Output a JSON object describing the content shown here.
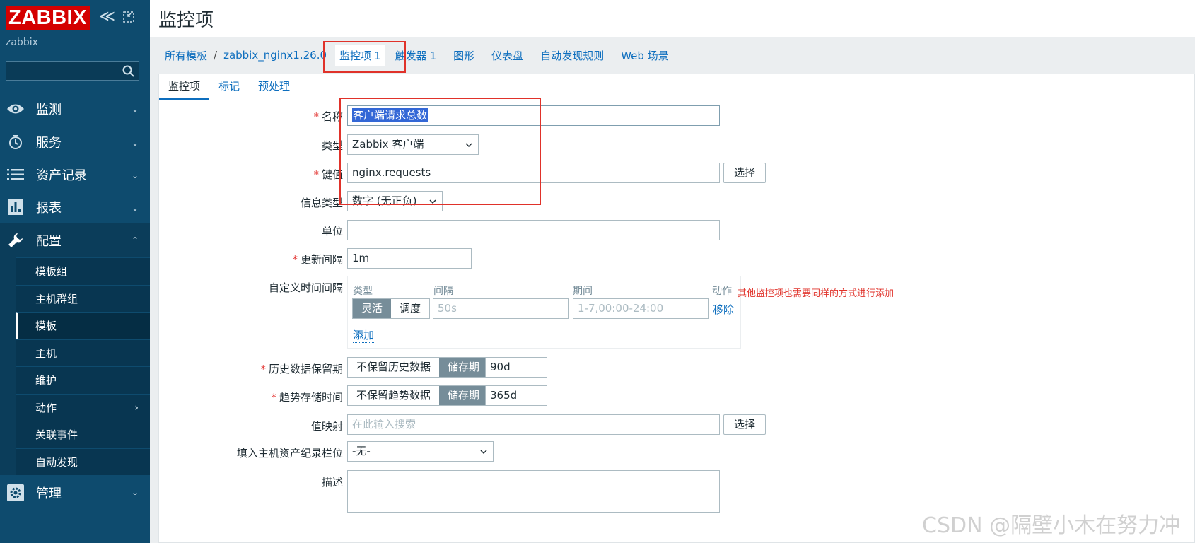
{
  "sidebar": {
    "logo": "ZABBIX",
    "server_name": "zabbix",
    "collapse_glyph": "≪",
    "menu": [
      {
        "label": "监测",
        "icon": "eye-icon",
        "arrow": "⌄"
      },
      {
        "label": "服务",
        "icon": "clock-icon",
        "arrow": "⌄"
      },
      {
        "label": "资产记录",
        "icon": "list-icon",
        "arrow": "⌄"
      },
      {
        "label": "报表",
        "icon": "bar-chart-icon",
        "arrow": "⌄"
      },
      {
        "label": "配置",
        "icon": "wrench-icon",
        "arrow": "⌃"
      },
      {
        "label": "管理",
        "icon": "gear-icon",
        "arrow": "⌄"
      }
    ],
    "submenu": [
      {
        "label": "模板组"
      },
      {
        "label": "主机群组"
      },
      {
        "label": "模板"
      },
      {
        "label": "主机"
      },
      {
        "label": "维护"
      },
      {
        "label": "动作",
        "arrow": "›"
      },
      {
        "label": "关联事件"
      },
      {
        "label": "自动发现"
      }
    ]
  },
  "header": {
    "title": "监控项"
  },
  "breadcrumb": {
    "all_templates": "所有模板",
    "separator": "/",
    "template": "zabbix_nginx1.26.0",
    "tabs": [
      {
        "label": "监控项",
        "count": "1"
      },
      {
        "label": "触发器",
        "count": "1"
      },
      {
        "label": "图形"
      },
      {
        "label": "仪表盘"
      },
      {
        "label": "自动发现规则"
      },
      {
        "label": "Web 场景"
      }
    ]
  },
  "tabs": [
    "监控项",
    "标记",
    "预处理"
  ],
  "form": {
    "name": {
      "label": "名称",
      "value": "客户端请求总数"
    },
    "type": {
      "label": "类型",
      "value": "Zabbix 客户端"
    },
    "key": {
      "label": "键值",
      "value": "nginx.requests",
      "button": "选择"
    },
    "info_type": {
      "label": "信息类型",
      "value": "数字 (无正负)"
    },
    "units": {
      "label": "单位",
      "value": ""
    },
    "update_interval": {
      "label": "更新间隔",
      "value": "1m"
    },
    "custom_intervals": {
      "label": "自定义时间间隔",
      "headers": [
        "类型",
        "间隔",
        "期间",
        "动作"
      ],
      "type_options": [
        "灵活",
        "调度"
      ],
      "interval_placeholder": "50s",
      "period_placeholder": "1-7,00:00-24:00",
      "remove": "移除",
      "add": "添加"
    },
    "history": {
      "label": "历史数据保留期",
      "options": [
        "不保留历史数据",
        "储存期"
      ],
      "value": "90d"
    },
    "trends": {
      "label": "趋势存储时间",
      "options": [
        "不保留趋势数据",
        "储存期"
      ],
      "value": "365d"
    },
    "valuemap": {
      "label": "值映射",
      "placeholder": "在此输入搜索",
      "button": "选择"
    },
    "inventory": {
      "label": "填入主机资产纪录栏位",
      "value": "-无-"
    },
    "description": {
      "label": "描述"
    }
  },
  "annotation": "其他监控项也需要同样的方式进行添加",
  "watermark": "CSDN @隔壁小木在努力冲",
  "colors": {
    "sidebar": "#0e4b6e",
    "accent": "#0d6ebe",
    "logo": "#d40000",
    "annotation": "#e0322a"
  }
}
